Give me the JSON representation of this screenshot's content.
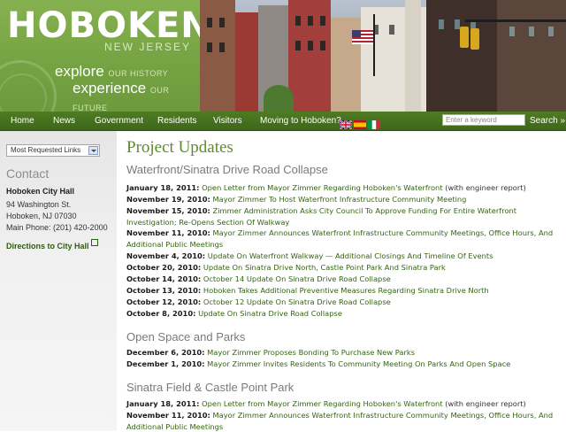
{
  "header": {
    "logo_title": "HOBOKEN",
    "logo_state": "NEW JERSEY",
    "tagline_1_big": "explore",
    "tagline_1_small": "OUR HISTORY",
    "tagline_2_big": "experience",
    "tagline_2_small": "OUR FUTURE"
  },
  "nav": {
    "items": [
      "Home",
      "News",
      "Government",
      "Residents",
      "Visitors",
      "Moving to Hoboken?"
    ],
    "search_placeholder": "Enter a keyword",
    "search_button": "Search »"
  },
  "sidebar": {
    "select_value": "Most Requested Links",
    "contact_title": "Contact",
    "hall_name": "Hoboken City Hall",
    "address_1": "94 Washington St.",
    "address_2": "Hoboken, NJ 07030",
    "phone": "Main Phone: (201) 420-2000",
    "directions": "Directions to City Hall"
  },
  "main": {
    "title": "Project Updates",
    "sections": [
      {
        "heading": "Waterfront/Sinatra Drive Road Collapse",
        "items": [
          {
            "date": "January 18, 2011:",
            "link": "Open Letter from Mayor Zimmer Regarding Hoboken's Waterfront",
            "note": "(with engineer report)"
          },
          {
            "date": "November 19, 2010:",
            "link": "Mayor Zimmer To Host Waterfront Infrastructure Community Meeting"
          },
          {
            "date": "November 15, 2010:",
            "link": "Zimmer Administration Asks City Council To Approve Funding For Entire Waterfront Investigation; Re-Opens Section Of Walkway"
          },
          {
            "date": "November 11, 2010:",
            "link": "Mayor Zimmer Announces Waterfront Infrastructure Community Meetings, Office Hours, And Additional Public Meetings"
          },
          {
            "date": "November 4, 2010:",
            "link": "Update On Waterfront Walkway — Additional Closings And Timeline Of Events"
          },
          {
            "date": "October 20, 2010:",
            "link": "Update On Sinatra Drive North, Castle Point Park And Sinatra Park"
          },
          {
            "date": "October 14, 2010:",
            "link": "October 14 Update On Sinatra Drive Road Collapse"
          },
          {
            "date": "October 13, 2010:",
            "link": "Hoboken Takes Additional Preventive Measures Regarding Sinatra Drive North"
          },
          {
            "date": "October 12, 2010:",
            "link": "October 12 Update On Sinatra Drive Road Collapse"
          },
          {
            "date": "October 8, 2010:",
            "link": "Update On Sinatra Drive Road Collapse"
          }
        ]
      },
      {
        "heading": "Open Space and Parks",
        "items": [
          {
            "date": "December 6, 2010:",
            "link": "Mayor Zimmer Proposes Bonding To Purchase New Parks"
          },
          {
            "date": "December 1, 2010:",
            "link": "Mayor Zimmer Invites Residents To Community Meeting On Parks And Open Space"
          }
        ]
      },
      {
        "heading": "Sinatra Field & Castle Point Park",
        "items": [
          {
            "date": "January 18, 2011:",
            "link": "Open Letter from Mayor Zimmer Regarding Hoboken's Waterfront",
            "note": "(with engineer report)"
          },
          {
            "date": "November 11, 2010:",
            "link": "Mayor Zimmer Announces Waterfront Infrastructure Community Meetings, Office Hours, And Additional Public Meetings"
          }
        ]
      }
    ]
  },
  "colors": {
    "brand_green": "#76a343",
    "nav_green": "#4a7520",
    "link_green": "#33650f",
    "title_green": "#5d8b2d"
  }
}
